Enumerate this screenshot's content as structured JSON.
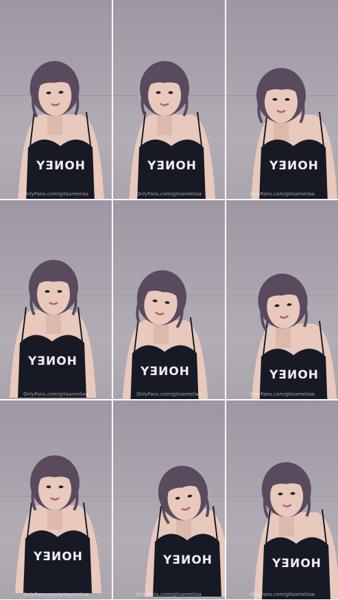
{
  "frames": [
    {
      "shirt_text": "HONEY",
      "watermark": "OnlyFans.com/gitaameliaa"
    },
    {
      "shirt_text": "HONEY",
      "watermark": "OnlyFans.com/gitaameliaa"
    },
    {
      "shirt_text": "HONEY",
      "watermark": "OnlyFans.com/gitaameliaa"
    },
    {
      "shirt_text": "HONEY",
      "watermark": "OnlyFans.com/gitaameliaa"
    },
    {
      "shirt_text": "HONEY",
      "watermark": "OnlyFans.com/gitaameliaa"
    },
    {
      "shirt_text": "HONEY",
      "watermark": "OnlyFans.com/gitaameliaa"
    },
    {
      "shirt_text": "HONEY",
      "watermark": "OnlyFans.com/gitaameliaa"
    },
    {
      "shirt_text": "HONEY",
      "watermark": "OnlyFans.com/gitaameliaa"
    },
    {
      "shirt_text": "HONEY",
      "watermark": "OnlyFans.com/gitaameliaa"
    }
  ],
  "colors": {
    "background": "#a9a3ad",
    "hair": "#5a4a5e",
    "skin": "#e8c9bc",
    "top": "#171a24"
  }
}
